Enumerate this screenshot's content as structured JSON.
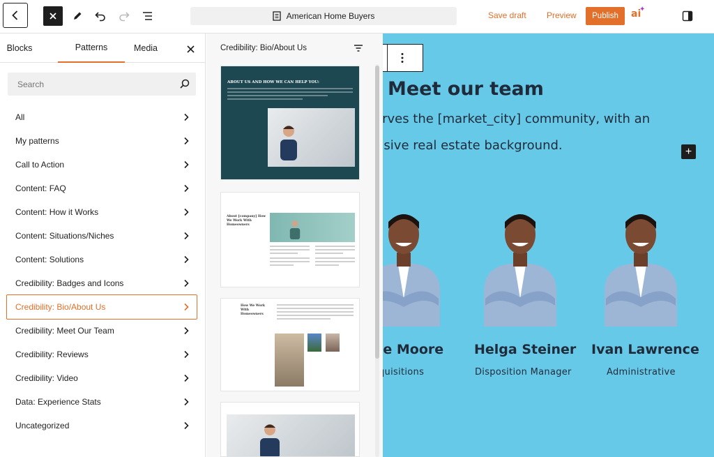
{
  "toolbar": {
    "document_title": "American Home Buyers",
    "save_draft_label": "Save draft",
    "preview_label": "Preview",
    "publish_label": "Publish",
    "ai_logo_text": "ai"
  },
  "inserter": {
    "tabs": [
      {
        "label": "Blocks"
      },
      {
        "label": "Patterns"
      },
      {
        "label": "Media"
      }
    ],
    "search_placeholder": "Search",
    "categories": [
      {
        "label": "All"
      },
      {
        "label": "My patterns"
      },
      {
        "label": "Call to Action"
      },
      {
        "label": "Content: FAQ"
      },
      {
        "label": "Content: How it Works"
      },
      {
        "label": "Content: Situations/Niches"
      },
      {
        "label": "Content: Solutions"
      },
      {
        "label": "Credibility: Badges and Icons"
      },
      {
        "label": "Credibility: Bio/About Us"
      },
      {
        "label": "Credibility: Meet Our Team"
      },
      {
        "label": "Credibility: Reviews"
      },
      {
        "label": "Credibility: Video"
      },
      {
        "label": "Data: Experience Stats"
      },
      {
        "label": "Uncategorized"
      }
    ],
    "active_category": "Credibility: Bio/About Us"
  },
  "pattern_panel": {
    "title": "Credibility: Bio/About Us",
    "card1_title": "ABOUT US AND HOW WE CAN HELP YOU:",
    "card2_title": "About [company] How We Work With Homeowners",
    "card3_title": "How We Work With Homeowners"
  },
  "canvas": {
    "heading": "Meet our team",
    "body_line1": "erves the [market_city] community, with an",
    "body_line2": "nsive real estate background.",
    "team": [
      {
        "name": "ye Moore",
        "role": "quisitions"
      },
      {
        "name": "Helga Steiner",
        "role": "Disposition Manager"
      },
      {
        "name": "Ivan Lawrence",
        "role": "Administrative"
      }
    ]
  },
  "colors": {
    "accent": "#e26f2a",
    "canvas_bg": "#67c9e8",
    "card_dark": "#1d4852",
    "text_dark": "#1f2b3a"
  }
}
